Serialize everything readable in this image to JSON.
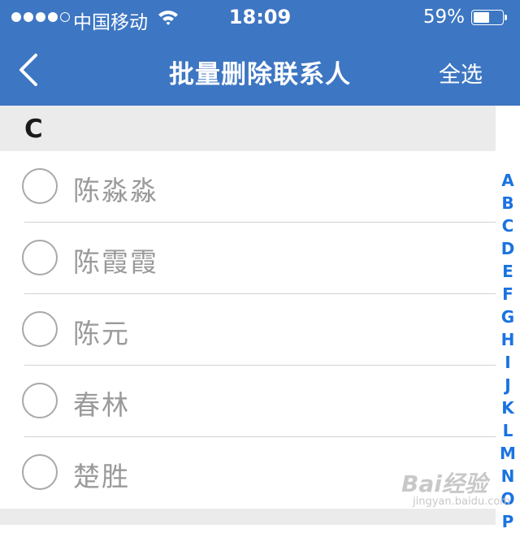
{
  "status_bar": {
    "carrier": "中国移动",
    "time": "18:09",
    "battery_percent": "59%",
    "battery_level": 0.59,
    "signal_filled": 4,
    "signal_total": 5
  },
  "nav": {
    "title": "批量删除联系人",
    "select_all_label": "全选",
    "back_icon": "chevron-left-icon"
  },
  "section": {
    "letter": "C",
    "contacts": [
      {
        "name": "陈淼淼"
      },
      {
        "name": "陈霞霞"
      },
      {
        "name": "陈元"
      },
      {
        "name": "春林"
      },
      {
        "name": "楚胜"
      }
    ]
  },
  "index_letters": [
    "A",
    "B",
    "C",
    "D",
    "E",
    "F",
    "G",
    "H",
    "I",
    "J",
    "K",
    "L",
    "M",
    "N",
    "O",
    "P"
  ],
  "watermark": {
    "logo": "Bai经验",
    "sub": "jingyan.baidu.com"
  },
  "colors": {
    "header_bg": "#3d76c2",
    "index_letter": "#1a73e0",
    "section_bg": "#ebebeb",
    "name_text": "#9a9a9a"
  }
}
